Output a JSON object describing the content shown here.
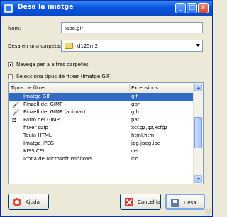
{
  "window": {
    "title": "Desa la imatge",
    "controls": {
      "minimize": "_",
      "maximize": "□",
      "close": "×"
    }
  },
  "form": {
    "name_label": "Nom:",
    "name_value": "japo.gif",
    "folder_label": "Desa en una carpeta:",
    "folder_value": "d125m2"
  },
  "browse_expander": {
    "label": "Navega per a altres carpetes",
    "expanded": false
  },
  "filetype_expander": {
    "label": "Selecciona tipus de fitxer (Imatge GIF)",
    "expanded": true
  },
  "filetypes": {
    "columns": [
      "Tipus de fitxer",
      "Extensions"
    ],
    "rows": [
      {
        "icon": "",
        "name": "Imatge GIF",
        "ext": "gif",
        "selected": true
      },
      {
        "icon": "paintbrush-icon",
        "name": "Pinzell del GIMP",
        "ext": "gbr",
        "selected": false
      },
      {
        "icon": "paintbrush-icon",
        "name": "Pinzell del GIMP (animat)",
        "ext": "gih",
        "selected": false
      },
      {
        "icon": "bucket-icon",
        "name": "Patró del GIMP",
        "ext": "pat",
        "selected": false
      },
      {
        "icon": "",
        "name": "fitxer gzip",
        "ext": "xcf.gz,gz,xcfgz",
        "selected": false
      },
      {
        "icon": "",
        "name": "Taula HTML",
        "ext": "html,htm",
        "selected": false
      },
      {
        "icon": "",
        "name": "Imatge JPEG",
        "ext": "jpg,jpeg,jpe",
        "selected": false
      },
      {
        "icon": "",
        "name": "KISS CEL",
        "ext": "cel",
        "selected": false
      },
      {
        "icon": "",
        "name": "Icona de Microsoft Windows",
        "ext": "ico",
        "selected": false
      }
    ]
  },
  "buttons": {
    "help": "Ajuda",
    "cancel": "Cancel·la",
    "save": "Desa"
  },
  "colors": {
    "titlebar": "#0a54dd",
    "selection": "#316ac5",
    "window_bg": "#ece9d8"
  }
}
